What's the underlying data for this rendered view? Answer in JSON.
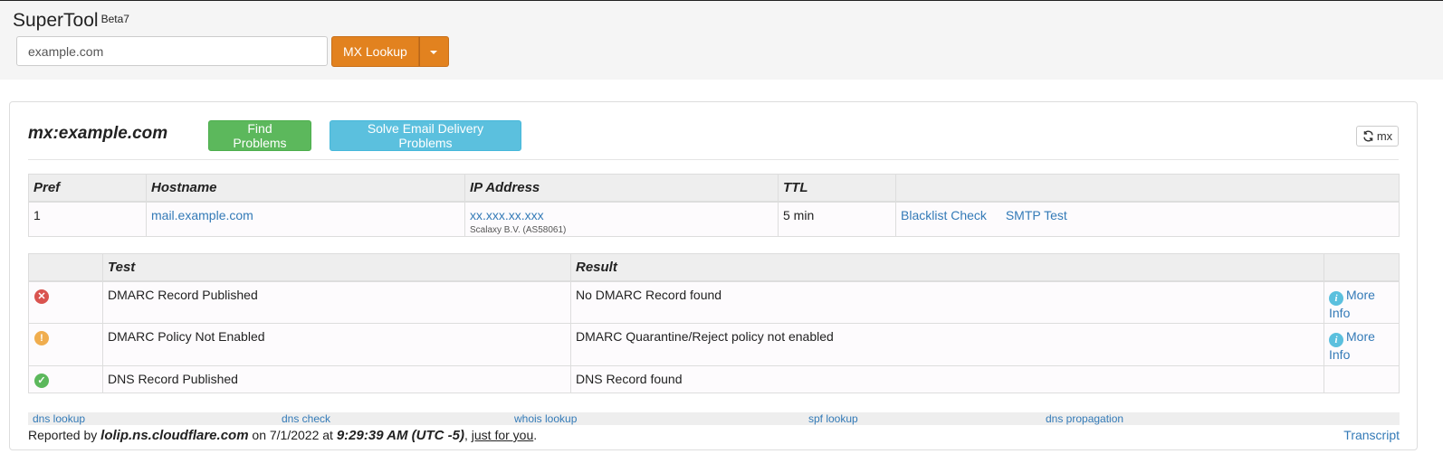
{
  "app": {
    "title": "SuperTool",
    "badge": "Beta7"
  },
  "search": {
    "value": "example.com",
    "placeholder": ""
  },
  "toolbar": {
    "lookup_label": "MX Lookup"
  },
  "result": {
    "title": "mx:example.com",
    "find_problems_label": "Find Problems",
    "solve_label": "Solve Email Delivery Problems",
    "refresh_label": "mx"
  },
  "mx_table": {
    "headers": [
      "Pref",
      "Hostname",
      "IP Address",
      "TTL",
      ""
    ],
    "rows": [
      {
        "pref": "1",
        "hostname": "mail.example.com",
        "ip": "xx.xxx.xx.xxx",
        "ip_owner": "Scalaxy B.V. (AS58061)",
        "ttl": "5 min",
        "action_blacklist": "Blacklist Check",
        "action_smtp": "SMTP Test"
      }
    ]
  },
  "test_table": {
    "headers": [
      "",
      "Test",
      "Result",
      ""
    ],
    "rows": [
      {
        "status": "error",
        "test": "DMARC Record Published",
        "result": "No DMARC Record found",
        "more_info": "More Info"
      },
      {
        "status": "warning",
        "test": "DMARC Policy Not Enabled",
        "result": "DMARC Quarantine/Reject policy not enabled",
        "more_info": "More Info"
      },
      {
        "status": "ok",
        "test": "DNS Record Published",
        "result": "DNS Record found",
        "more_info": ""
      }
    ]
  },
  "footer": {
    "links": [
      "dns lookup",
      "dns check",
      "whois lookup",
      "spf lookup",
      "dns propagation"
    ],
    "reported_prefix": "Reported by",
    "server": "lolip.ns.cloudflare.com",
    "on": "on 7/1/2022 at",
    "time": "9:29:39 AM (UTC -5)",
    "comma": ",",
    "just_for_you": "just for you",
    "period": ".",
    "transcript": "Transcript"
  },
  "colors": {
    "accent_orange": "#e2821f",
    "success_green": "#5cb85c",
    "info_cyan": "#5bc0de",
    "error_red": "#d9534f",
    "warning_orange": "#f0ad4e",
    "link_blue": "#337ab7"
  },
  "icons": {
    "refresh": "refresh-icon",
    "caret": "chevron-down-icon",
    "error": "error-circle-icon",
    "warning": "warning-circle-icon",
    "ok": "check-circle-icon",
    "info": "info-circle-icon"
  }
}
